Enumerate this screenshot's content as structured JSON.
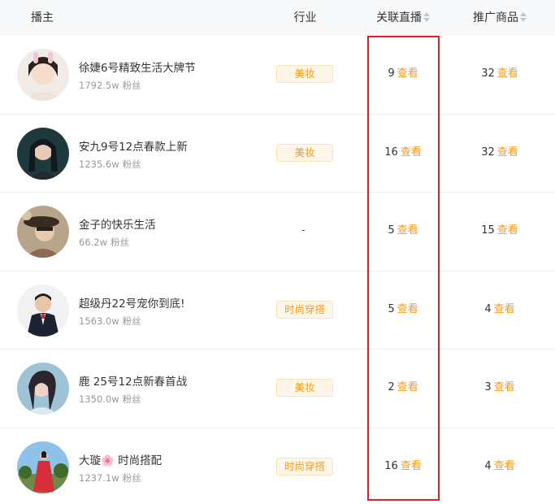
{
  "header": {
    "anchor": "播主",
    "industry": "行业",
    "live": "关联直播",
    "goods": "推广商品"
  },
  "rows": [
    {
      "name": "徐婕6号精致生活大牌节",
      "fans": "1792.5w",
      "fans_unit": "粉丝",
      "industry": "美妆",
      "live_count": "9",
      "goods_count": "32",
      "view": "查看"
    },
    {
      "name": "安九9号12点春款上新",
      "fans": "1235.6w",
      "fans_unit": "粉丝",
      "industry": "美妆",
      "live_count": "16",
      "goods_count": "32",
      "view": "查看"
    },
    {
      "name": "金子的快乐生活",
      "fans": "66.2w",
      "fans_unit": "粉丝",
      "industry": "-",
      "live_count": "5",
      "goods_count": "15",
      "view": "查看"
    },
    {
      "name": "超级丹22号宠你到底!",
      "fans": "1563.0w",
      "fans_unit": "粉丝",
      "industry": "时尚穿搭",
      "live_count": "5",
      "goods_count": "4",
      "view": "查看"
    },
    {
      "name": "鹿 25号12点新春首战",
      "fans": "1350.0w",
      "fans_unit": "粉丝",
      "industry": "美妆",
      "live_count": "2",
      "goods_count": "3",
      "view": "查看"
    },
    {
      "name": "大璇🌸 时尚搭配",
      "fans": "1237.1w",
      "fans_unit": "粉丝",
      "industry": "时尚穿搭",
      "live_count": "16",
      "goods_count": "4",
      "view": "查看"
    }
  ],
  "colors": {
    "accent": "#f59a23",
    "highlight_border": "#e0201e",
    "header_bg": "#f7f8fa"
  }
}
